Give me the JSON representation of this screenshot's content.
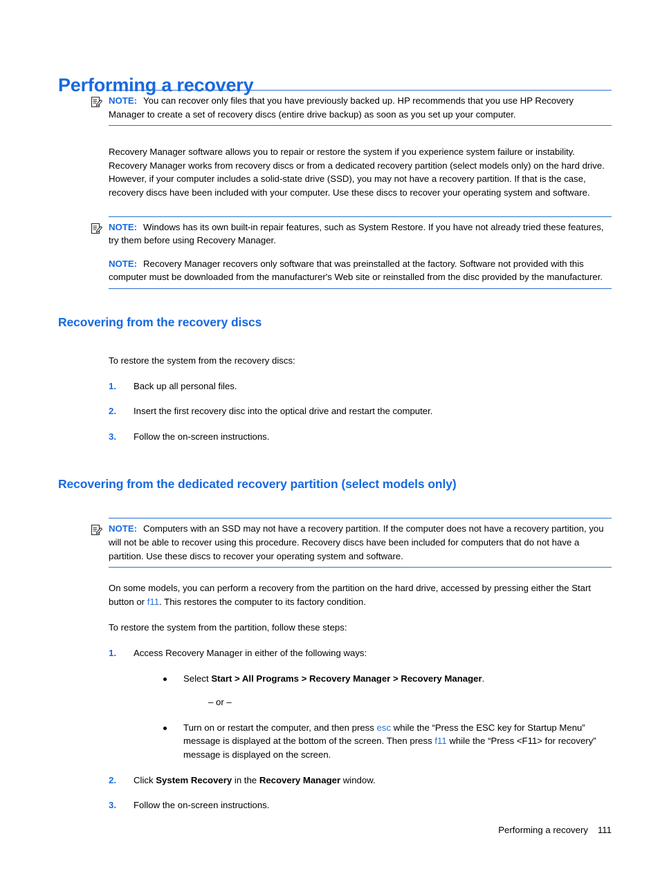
{
  "page": {
    "title": "Performing a recovery",
    "footer_title": "Performing a recovery",
    "footer_page": "111",
    "accent_blue": "#1769e0",
    "link_blue": "#2a6fd4"
  },
  "note_label": "NOTE:",
  "icons": {
    "note": "note-pencil-icon"
  },
  "notes": {
    "note1": "You can recover only files that you have previously backed up. HP recommends that you use HP Recovery Manager to create a set of recovery discs (entire drive backup) as soon as you set up your computer.",
    "note2": "Windows has its own built-in repair features, such as System Restore. If you have not already tried these features, try them before using Recovery Manager.",
    "note3": "Recovery Manager recovers only software that was preinstalled at the factory. Software not provided with this computer must be downloaded from the manufacturer's Web site or reinstalled from the disc provided by the manufacturer.",
    "note4": "Computers with an SSD may not have a recovery partition. If the computer does not have a recovery partition, you will not be able to recover using this procedure. Recovery discs have been included for computers that do not have a partition. Use these discs to recover your operating system and software."
  },
  "intro_paragraph": "Recovery Manager software allows you to repair or restore the system if you experience system failure or instability. Recovery Manager works from recovery discs or from a dedicated recovery partition (select models only) on the hard drive. However, if your computer includes a solid-state drive (SSD), you may not have a recovery partition. If that is the case, recovery discs have been included with your computer. Use these discs to recover your operating system and software.",
  "section_discs": {
    "heading": "Recovering from the recovery discs",
    "lead": "To restore the system from the recovery discs:",
    "steps": [
      {
        "num": "1.",
        "text": "Back up all personal files."
      },
      {
        "num": "2.",
        "text": "Insert the first recovery disc into the optical drive and restart the computer."
      },
      {
        "num": "3.",
        "text": "Follow the on-screen instructions."
      }
    ]
  },
  "section_partition": {
    "heading": "Recovering from the dedicated recovery partition (select models only)",
    "para1_a": "On some models, you can perform a recovery from the partition on the hard drive, accessed by pressing either the Start button or ",
    "para1_link": "f11",
    "para1_b": ". This restores the computer to its factory condition.",
    "lead": "To restore the system from the partition, follow these steps:",
    "step1_num": "1.",
    "step1_text": "Access Recovery Manager in either of the following ways:",
    "bullet1_a": "Select ",
    "bullet1_bold": "Start > All Programs > Recovery Manager > Recovery Manager",
    "bullet1_b": ".",
    "or_text": "– or –",
    "bullet2_a": "Turn on or restart the computer, and then press ",
    "bullet2_link1": "esc",
    "bullet2_b": " while the “Press the ESC key for Startup Menu” message is displayed at the bottom of the screen. Then press ",
    "bullet2_link2": "f11",
    "bullet2_c": " while the “Press <F11> for recovery” message is displayed on the screen.",
    "step2_num": "2.",
    "step2_a": "Click ",
    "step2_bold1": "System Recovery",
    "step2_b": " in the ",
    "step2_bold2": "Recovery Manager",
    "step2_c": " window.",
    "step3_num": "3.",
    "step3_text": "Follow the on-screen instructions."
  }
}
